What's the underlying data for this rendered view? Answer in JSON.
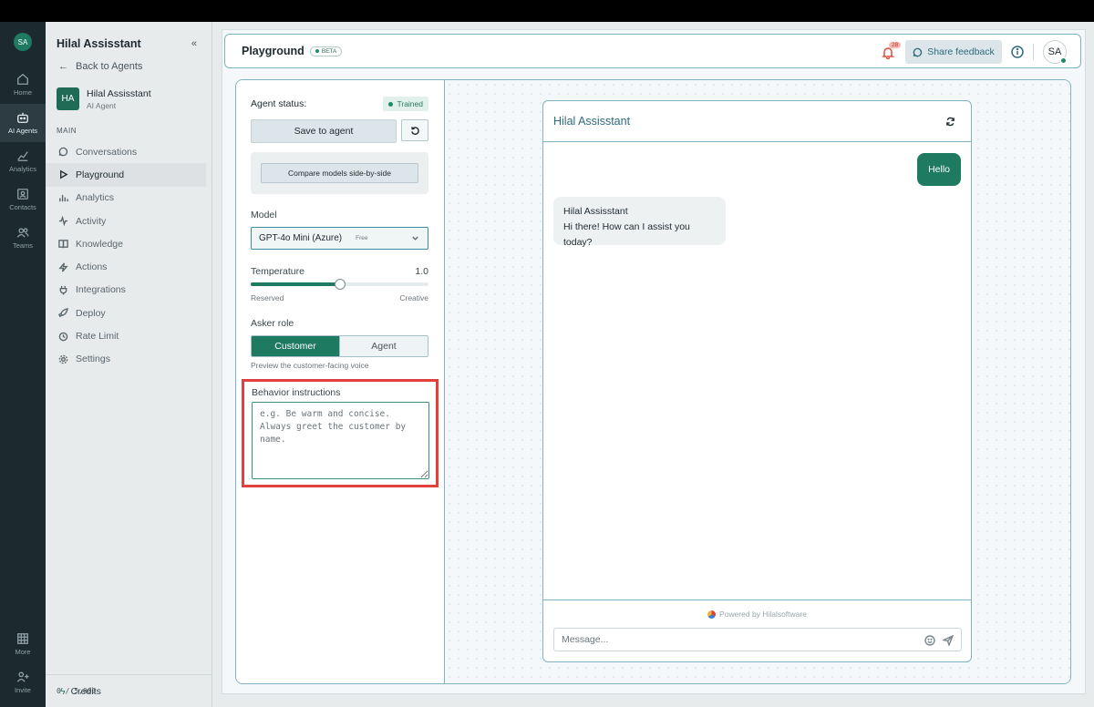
{
  "rail": {
    "user_initials": "SA",
    "items": [
      {
        "label": "Home",
        "icon": "home-icon"
      },
      {
        "label": "AI Agents",
        "icon": "robot-icon"
      },
      {
        "label": "Analytics",
        "icon": "chart-icon"
      },
      {
        "label": "Contacts",
        "icon": "contacts-icon"
      },
      {
        "label": "Teams",
        "icon": "team-icon"
      }
    ],
    "bottom": [
      {
        "label": "More",
        "icon": "grid-icon"
      },
      {
        "label": "Invite",
        "icon": "invite-icon"
      }
    ]
  },
  "sidebar": {
    "title": "Hilal Assisstant",
    "back_label": "Back to Agents",
    "agent": {
      "initials": "HA",
      "name": "Hilal Assisstant",
      "type": "AI Agent"
    },
    "section": "MAIN",
    "items": [
      {
        "label": "Conversations",
        "icon": "chat-icon"
      },
      {
        "label": "Playground",
        "icon": "play-icon"
      },
      {
        "label": "Analytics",
        "icon": "bar-chart-icon"
      },
      {
        "label": "Activity",
        "icon": "activity-icon"
      },
      {
        "label": "Knowledge",
        "icon": "book-icon"
      },
      {
        "label": "Actions",
        "icon": "bolt-icon"
      },
      {
        "label": "Integrations",
        "icon": "plug-icon"
      },
      {
        "label": "Deploy",
        "icon": "rocket-icon"
      },
      {
        "label": "Rate Limit",
        "icon": "clock-icon"
      },
      {
        "label": "Settings",
        "icon": "gear-icon"
      }
    ],
    "credits_label": "Credits",
    "credits_value": "0 / 5,000"
  },
  "topbar": {
    "title": "Playground",
    "beta": "BETA",
    "notification_count": "28",
    "share_label": "Share feedback",
    "user_initials": "SA"
  },
  "config": {
    "status_label": "Agent status:",
    "status_value": "Trained",
    "save_label": "Save to agent",
    "compare_label": "Compare models side-by-side",
    "model_label": "Model",
    "model_value": "GPT-4o Mini (Azure)",
    "model_tier": "Free",
    "temperature_label": "Temperature",
    "temperature_value": "1.0",
    "temperature_fraction": 0.5,
    "temp_min_label": "Reserved",
    "temp_max_label": "Creative",
    "role_label": "Asker role",
    "role_options": [
      "Customer",
      "Agent"
    ],
    "role_selected": "Customer",
    "role_hint": "Preview the customer-facing voice",
    "behavior_label": "Behavior instructions",
    "behavior_placeholder": "e.g. Be warm and concise. Always greet the customer by name."
  },
  "chat": {
    "title": "Hilal Assisstant",
    "user_message": "Hello",
    "bot_name": "Hilal Assisstant",
    "bot_message": "Hi there! How can I assist you today?",
    "powered_by": "Powered by Hilalsoftware",
    "input_placeholder": "Message..."
  },
  "colors": {
    "accent": "#1f7a62",
    "highlight": "#e0413d",
    "border": "#7fb3c4"
  }
}
